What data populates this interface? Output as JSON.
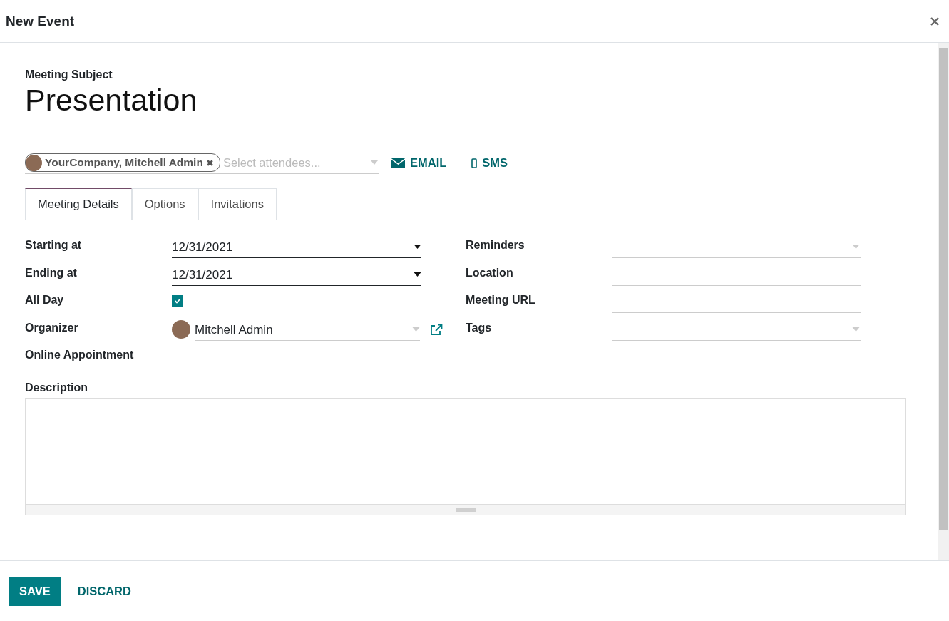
{
  "window": {
    "title": "New Event"
  },
  "subject": {
    "label": "Meeting Subject",
    "value": "Presentation"
  },
  "attendees": {
    "tags": [
      {
        "label": "YourCompany, Mitchell Admin"
      }
    ],
    "placeholder": "Select attendees..."
  },
  "actions": [
    {
      "kind": "email",
      "label": "EMAIL"
    },
    {
      "kind": "sms",
      "label": "SMS"
    }
  ],
  "tabs": [
    {
      "label": "Meeting Details",
      "selected": true
    },
    {
      "label": "Options",
      "selected": false
    },
    {
      "label": "Invitations",
      "selected": false
    }
  ],
  "fields_left": [
    {
      "label": "Starting at",
      "kind": "date",
      "value": "12/31/2021"
    },
    {
      "label": "Ending at",
      "kind": "date",
      "value": "12/31/2021"
    },
    {
      "label": "All Day",
      "kind": "checkbox",
      "checked": true
    },
    {
      "label": "Organizer",
      "kind": "person",
      "value": "Mitchell Admin"
    },
    {
      "label": "Online Appointment",
      "kind": "empty"
    }
  ],
  "fields_right": [
    {
      "label": "Reminders",
      "kind": "select"
    },
    {
      "label": "Location",
      "kind": "text"
    },
    {
      "label": "Meeting URL",
      "kind": "text"
    },
    {
      "label": "Tags",
      "kind": "select"
    }
  ],
  "description": {
    "label": "Description"
  },
  "buttons": [
    {
      "label": "SAVE",
      "kind": "primary"
    },
    {
      "label": "DISCARD",
      "kind": "link"
    }
  ]
}
